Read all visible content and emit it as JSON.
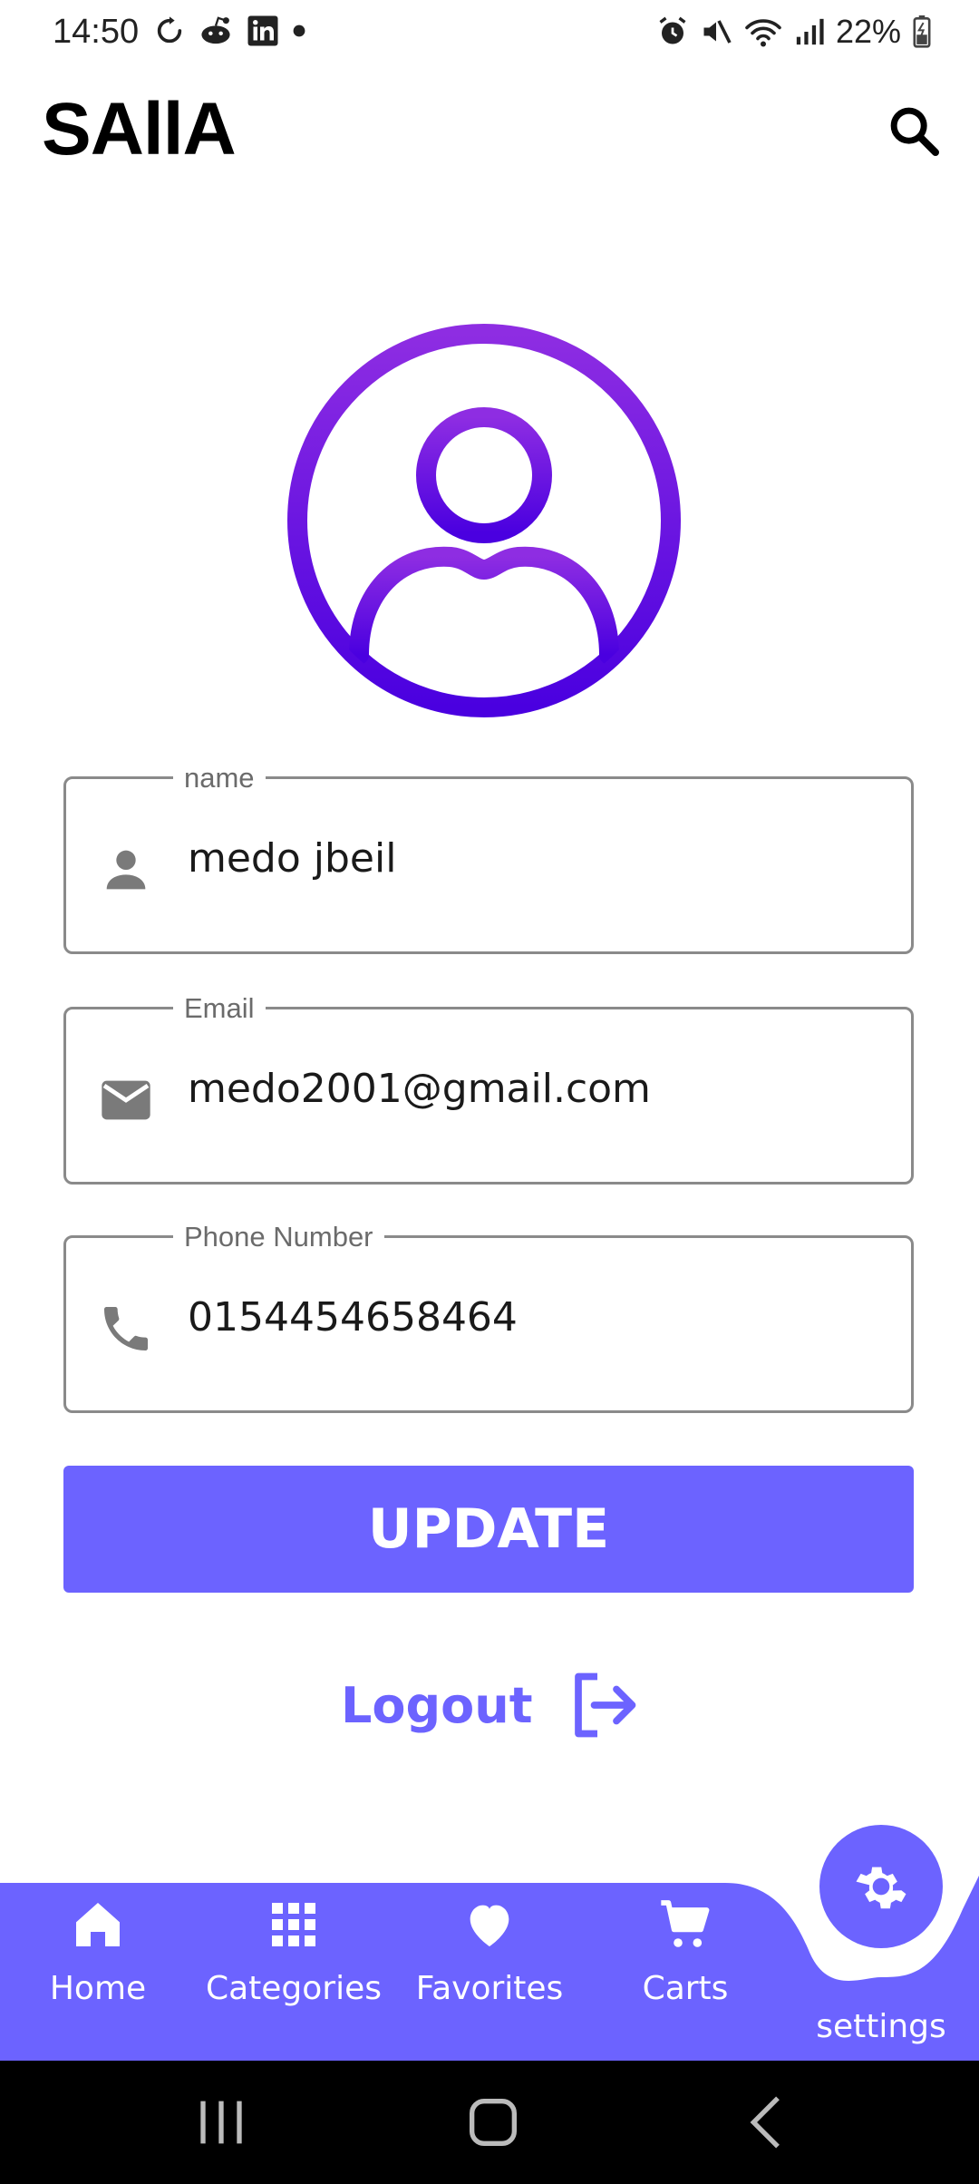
{
  "status_bar": {
    "time": "14:50",
    "battery": "22%",
    "left_icons": [
      "sync-icon",
      "reddit-icon",
      "linkedin-icon",
      "dot-icon"
    ],
    "right_icons": [
      "alarm-icon",
      "mute-icon",
      "wifi-icon",
      "signal-icon",
      "battery-charging-icon"
    ]
  },
  "app_bar": {
    "title": "SAllA",
    "search_icon": "search-icon"
  },
  "profile": {
    "avatar_icon": "user-avatar-icon",
    "fields": [
      {
        "label": "name",
        "value": "medo jbeil",
        "icon": "person-icon"
      },
      {
        "label": "Email",
        "value": "medo2001@gmail.com",
        "icon": "email-icon"
      },
      {
        "label": "Phone Number",
        "value": "0154454658464",
        "icon": "phone-icon"
      }
    ],
    "update_label": "UPDATE",
    "logout_label": "Logout"
  },
  "bottom_nav": {
    "items": [
      {
        "label": "Home",
        "icon": "home-icon"
      },
      {
        "label": "Categories",
        "icon": "grid-icon"
      },
      {
        "label": "Favorites",
        "icon": "heart-icon"
      },
      {
        "label": "Carts",
        "icon": "cart-icon"
      },
      {
        "label": "settings",
        "icon": "gear-icon",
        "active": true
      }
    ]
  },
  "colors": {
    "accent": "#6c63ff",
    "avatar_gradient_top": "#8e2de2",
    "avatar_gradient_bottom": "#4a00e0",
    "field_border": "#8a8a8a",
    "system_nav": "#000000"
  }
}
